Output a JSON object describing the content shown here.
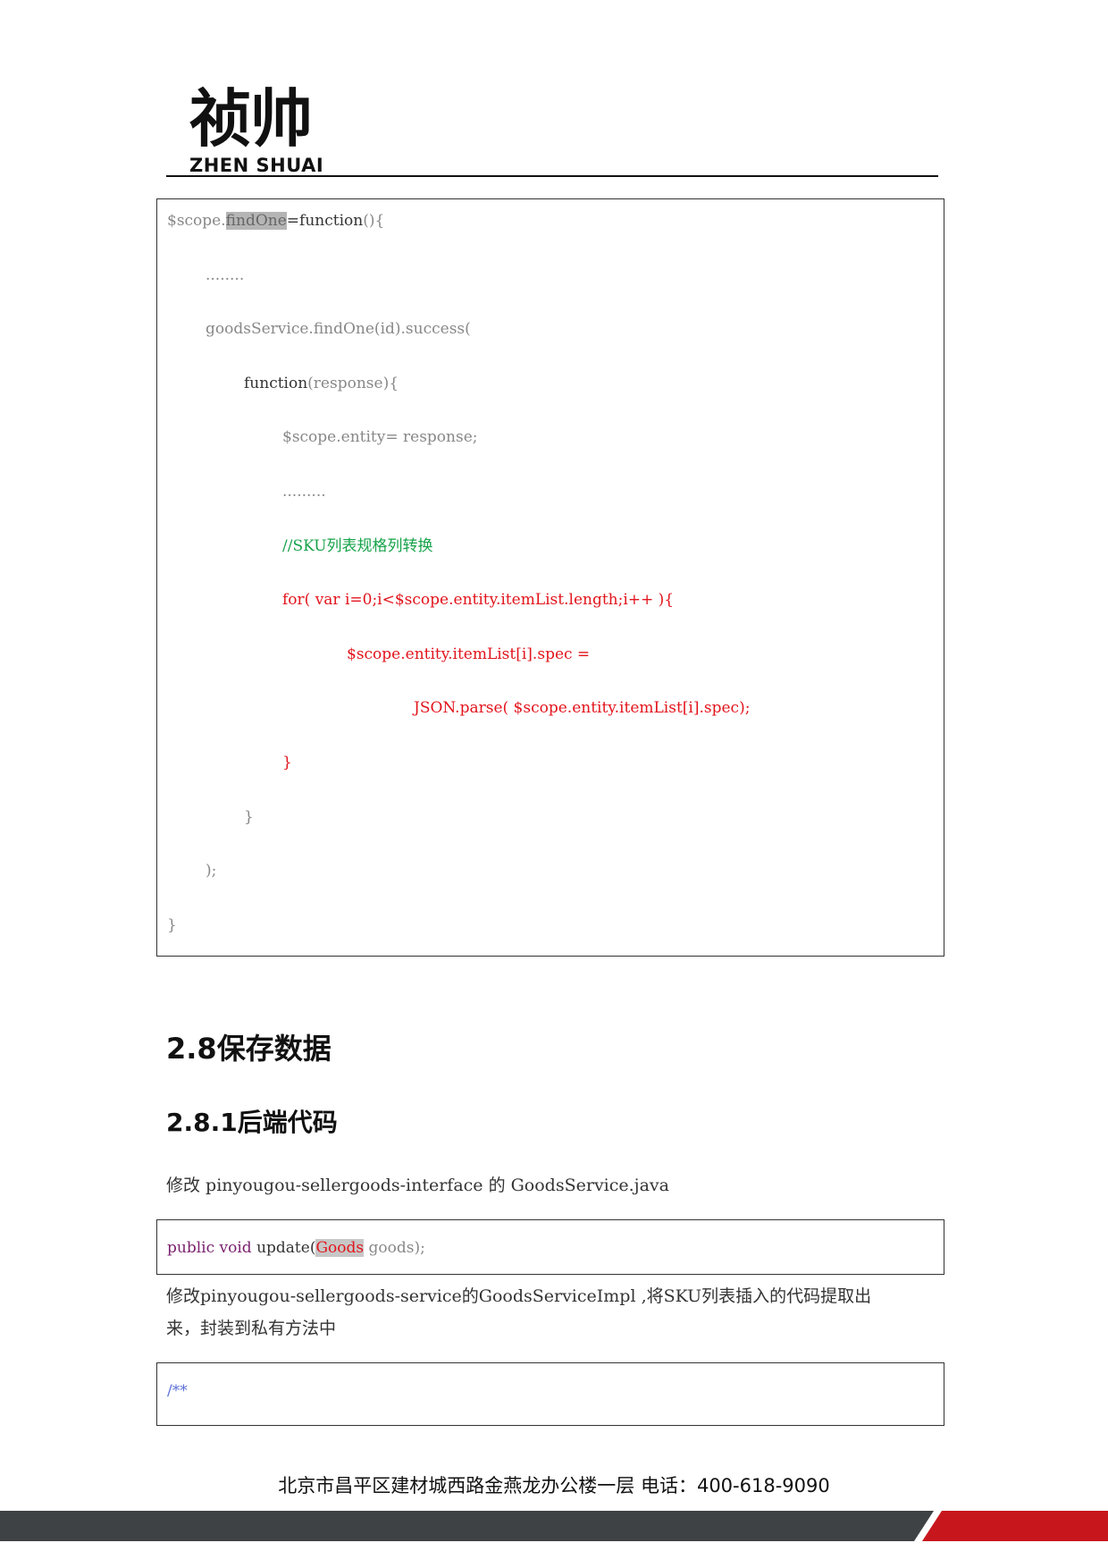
{
  "header": {
    "logo_cn": "祯帅",
    "logo_en": "ZHEN SHUAI"
  },
  "code_block_1": {
    "lines": [
      {
        "indent": 0,
        "segments": [
          {
            "text": "$scope.",
            "style": "grey"
          },
          {
            "text": "findOne",
            "style": "highlight"
          },
          {
            "text": "=function",
            "style": "dark"
          },
          {
            "text": "(){",
            "style": "grey"
          }
        ]
      },
      {
        "indent": 1,
        "segments": [
          {
            "text": "........",
            "style": "grey"
          }
        ]
      },
      {
        "indent": 1,
        "segments": [
          {
            "text": "goodsService.findOne(id).success(",
            "style": "grey"
          }
        ]
      },
      {
        "indent": 2,
        "segments": [
          {
            "text": "function",
            "style": "dark"
          },
          {
            "text": "(response){",
            "style": "grey"
          }
        ]
      },
      {
        "indent": 3,
        "segments": [
          {
            "text": "$scope.entity= response;",
            "style": "grey"
          }
        ]
      },
      {
        "indent": 3,
        "segments": [
          {
            "text": ".........",
            "style": "grey"
          }
        ]
      },
      {
        "indent": 3,
        "segments": [
          {
            "text": "//SKU列表规格列转换",
            "style": "green"
          }
        ]
      },
      {
        "indent": 3,
        "segments": [
          {
            "text": "for( var i=0;i<$scope.entity.itemList.length;i++ ){",
            "style": "red"
          }
        ]
      },
      {
        "indent": 4,
        "segments": [
          {
            "text": "$scope.entity.itemList[i].spec =",
            "style": "red"
          }
        ]
      },
      {
        "indent": 5,
        "segments": [
          {
            "text": "JSON.parse( $scope.entity.itemList[i].spec);",
            "style": "red"
          }
        ]
      },
      {
        "indent": 3,
        "segments": [
          {
            "text": "}",
            "style": "red"
          }
        ]
      },
      {
        "indent": 2,
        "segments": [
          {
            "text": "}",
            "style": "grey"
          }
        ]
      },
      {
        "indent": 1,
        "segments": [
          {
            "text": ");",
            "style": "grey"
          }
        ]
      },
      {
        "indent": 0,
        "segments": [
          {
            "text": "}",
            "style": "grey"
          }
        ]
      }
    ]
  },
  "heading_2_8": "2.8保存数据",
  "heading_2_8_1": "2.8.1后端代码",
  "para_1": "修改 pinyougou-sellergoods-interface 的 GoodsService.java",
  "code_block_2": {
    "kw": "public void",
    "method": " update(",
    "type": "Goods",
    "rest": " goods);"
  },
  "para_2_line1": "修改pinyougou-sellergoods-service的GoodsServiceImpl  ,将SKU列表插入的代码提取出",
  "para_2_line2": "来，封装到私有方法中",
  "code_block_3": {
    "text": "/**"
  },
  "footer": {
    "address": "北京市昌平区建材城西路金燕龙办公楼一层   电话：400-618-9090"
  },
  "colors": {
    "footer_dark": "#3f4244",
    "footer_red": "#c8161d"
  }
}
